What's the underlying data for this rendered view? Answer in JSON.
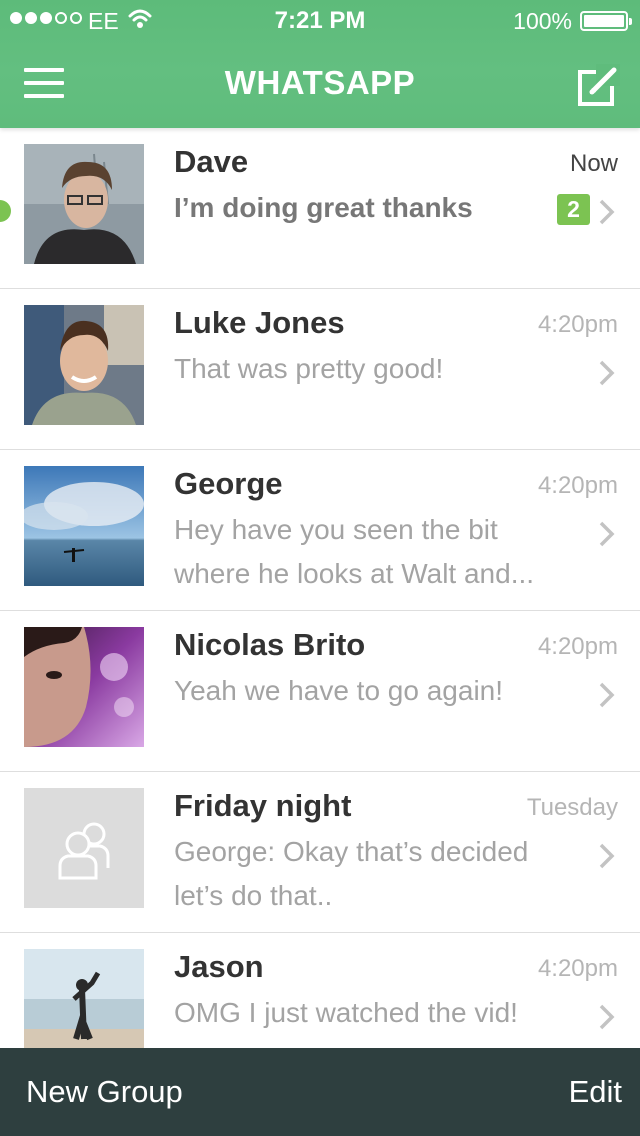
{
  "status_bar": {
    "carrier": "EE",
    "time": "7:21 PM",
    "battery_percent": "100%",
    "signal_bars_filled": 3,
    "signal_bars_total": 5
  },
  "header": {
    "title": "WHATSAPP",
    "menu_icon": "hamburger-menu-icon",
    "compose_icon": "compose-icon",
    "background_color": "#62be7f"
  },
  "chats": [
    {
      "name": "Dave",
      "time": "Now",
      "preview": "I’m doing great thanks",
      "unread_count": "2",
      "unread": true,
      "avatar": "photo-person-glasses"
    },
    {
      "name": "Luke Jones",
      "time": "4:20pm",
      "preview": "That was pretty good!",
      "unread_count": "",
      "unread": false,
      "avatar": "photo-person-smiling"
    },
    {
      "name": "George",
      "time": "4:20pm",
      "preview": "Hey have you seen the bit where he looks at Walt and...",
      "unread_count": "",
      "unread": false,
      "avatar": "photo-sea-figure"
    },
    {
      "name": "Nicolas Brito",
      "time": "4:20pm",
      "preview": "Yeah we have to go again!",
      "unread_count": "",
      "unread": false,
      "avatar": "photo-face-purple"
    },
    {
      "name": "Friday night",
      "time": "Tuesday",
      "preview": "George: Okay that’s decided let’s do that..",
      "unread_count": "",
      "unread": false,
      "avatar": "group-placeholder-icon"
    },
    {
      "name": "Jason",
      "time": "4:20pm",
      "preview": "OMG I just watched the vid!",
      "unread_count": "",
      "unread": false,
      "avatar": "photo-beach-person"
    }
  ],
  "bottom_bar": {
    "new_group_label": "New Group",
    "edit_label": "Edit",
    "background_color": "#2e3f3f"
  },
  "colors": {
    "accent_green": "#62be7f",
    "badge_green": "#7cc352"
  }
}
